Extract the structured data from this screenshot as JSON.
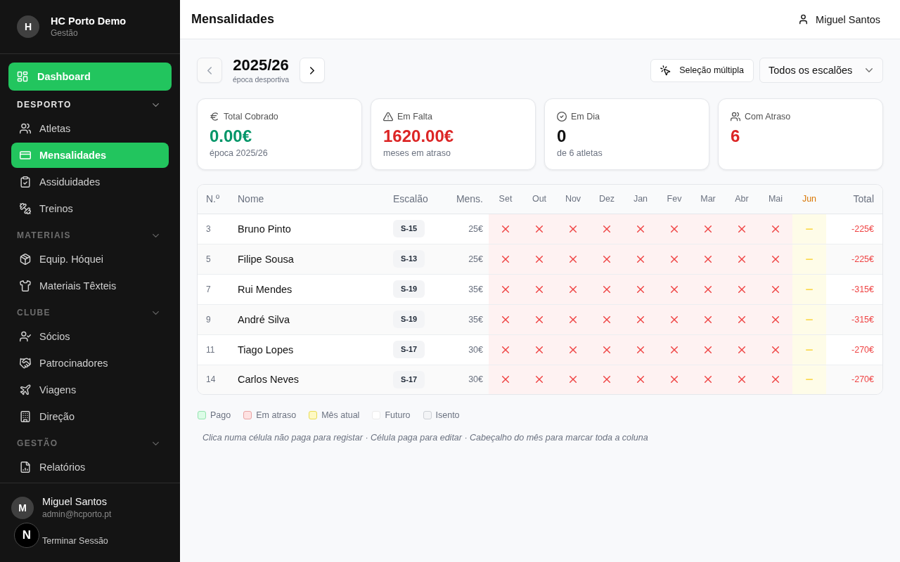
{
  "sidebar": {
    "brand": {
      "avatar": "H",
      "name": "HC Porto Demo",
      "subtitle": "Gestão"
    },
    "dashboard": {
      "label": "Dashboard",
      "selected": true
    },
    "sections": [
      {
        "title": "DESPORTO",
        "active": true,
        "expanded": true,
        "items": [
          {
            "label": "Atletas",
            "selected": false
          },
          {
            "label": "Mensalidades",
            "selected": true
          },
          {
            "label": "Assiduidades",
            "selected": false
          },
          {
            "label": "Treinos",
            "selected": false
          }
        ]
      },
      {
        "title": "MATERIAIS",
        "active": false,
        "expanded": true,
        "items": [
          {
            "label": "Equip. Hóquei",
            "selected": false
          },
          {
            "label": "Materiais Têxteis",
            "selected": false
          }
        ]
      },
      {
        "title": "CLUBE",
        "active": false,
        "expanded": true,
        "items": [
          {
            "label": "Sócios",
            "selected": false
          },
          {
            "label": "Patrocinadores",
            "selected": false
          },
          {
            "label": "Viagens",
            "selected": false
          },
          {
            "label": "Direção",
            "selected": false
          }
        ]
      },
      {
        "title": "GESTÃO",
        "active": false,
        "expanded": true,
        "items": [
          {
            "label": "Relatórios",
            "selected": false
          }
        ]
      }
    ],
    "user": {
      "avatar": "M",
      "name": "Miguel Santos",
      "email": "admin@hcporto.pt"
    },
    "logout": {
      "label": "Terminar Sessão"
    },
    "dev_badge": {
      "label": "N"
    }
  },
  "top_bar": {
    "title": "Mensalidades",
    "user": "Miguel Santos"
  },
  "season": {
    "label": "2025/26",
    "caption": "época desportiva",
    "prev_button": {
      "disabled": true
    },
    "next_button": {
      "disabled": false
    }
  },
  "toolbar": {
    "multi_select_button": "Seleção múltipla",
    "filter": {
      "value": "Todos os escalões"
    }
  },
  "stats": [
    {
      "label": "Total Cobrado",
      "value": "0.00€",
      "note": "época 2025/26",
      "color": "#059669"
    },
    {
      "label": "Em Falta",
      "value": "1620.00€",
      "note": "meses em atraso",
      "color": "#dc2626"
    },
    {
      "label": "Em Dia",
      "value": "0",
      "note": "de 6 atletas",
      "color": "#111111"
    },
    {
      "label": "Com Atraso",
      "value": "6",
      "color": "#dc2626"
    }
  ],
  "table": {
    "columns": {
      "number": "N.º",
      "name": "Nome",
      "team": "Escalão",
      "fee": "Mens.",
      "total": "Total"
    },
    "months": [
      {
        "label": "Set",
        "current": false
      },
      {
        "label": "Out",
        "current": false
      },
      {
        "label": "Nov",
        "current": false
      },
      {
        "label": "Dez",
        "current": false
      },
      {
        "label": "Jan",
        "current": false
      },
      {
        "label": "Fev",
        "current": false
      },
      {
        "label": "Mar",
        "current": false
      },
      {
        "label": "Abr",
        "current": false
      },
      {
        "label": "Mai",
        "current": false
      },
      {
        "label": "Jun",
        "current": true
      }
    ],
    "rows": [
      {
        "number": "3",
        "name": "Bruno Pinto",
        "team": "S-15",
        "fee": "25€",
        "months": [
          {
            "kind": "overdue"
          },
          {
            "kind": "overdue"
          },
          {
            "kind": "overdue"
          },
          {
            "kind": "overdue"
          },
          {
            "kind": "overdue"
          },
          {
            "kind": "overdue"
          },
          {
            "kind": "overdue"
          },
          {
            "kind": "overdue"
          },
          {
            "kind": "overdue"
          },
          {
            "kind": "current"
          }
        ],
        "total": "-225€"
      },
      {
        "number": "5",
        "name": "Filipe Sousa",
        "team": "S-13",
        "fee": "25€",
        "months": [
          {
            "kind": "overdue"
          },
          {
            "kind": "overdue"
          },
          {
            "kind": "overdue"
          },
          {
            "kind": "overdue"
          },
          {
            "kind": "overdue"
          },
          {
            "kind": "overdue"
          },
          {
            "kind": "overdue"
          },
          {
            "kind": "overdue"
          },
          {
            "kind": "overdue"
          },
          {
            "kind": "current"
          }
        ],
        "total": "-225€"
      },
      {
        "number": "7",
        "name": "Rui Mendes",
        "team": "S-19",
        "fee": "35€",
        "months": [
          {
            "kind": "overdue"
          },
          {
            "kind": "overdue"
          },
          {
            "kind": "overdue"
          },
          {
            "kind": "overdue"
          },
          {
            "kind": "overdue"
          },
          {
            "kind": "overdue"
          },
          {
            "kind": "overdue"
          },
          {
            "kind": "overdue"
          },
          {
            "kind": "overdue"
          },
          {
            "kind": "current"
          }
        ],
        "total": "-315€"
      },
      {
        "number": "9",
        "name": "André Silva",
        "team": "S-19",
        "fee": "35€",
        "months": [
          {
            "kind": "overdue"
          },
          {
            "kind": "overdue"
          },
          {
            "kind": "overdue"
          },
          {
            "kind": "overdue"
          },
          {
            "kind": "overdue"
          },
          {
            "kind": "overdue"
          },
          {
            "kind": "overdue"
          },
          {
            "kind": "overdue"
          },
          {
            "kind": "overdue"
          },
          {
            "kind": "current"
          }
        ],
        "total": "-315€"
      },
      {
        "number": "11",
        "name": "Tiago Lopes",
        "team": "S-17",
        "fee": "30€",
        "months": [
          {
            "kind": "overdue"
          },
          {
            "kind": "overdue"
          },
          {
            "kind": "overdue"
          },
          {
            "kind": "overdue"
          },
          {
            "kind": "overdue"
          },
          {
            "kind": "overdue"
          },
          {
            "kind": "overdue"
          },
          {
            "kind": "overdue"
          },
          {
            "kind": "overdue"
          },
          {
            "kind": "current"
          }
        ],
        "total": "-270€"
      },
      {
        "number": "14",
        "name": "Carlos Neves",
        "team": "S-17",
        "fee": "30€",
        "months": [
          {
            "kind": "overdue"
          },
          {
            "kind": "overdue"
          },
          {
            "kind": "overdue"
          },
          {
            "kind": "overdue"
          },
          {
            "kind": "overdue"
          },
          {
            "kind": "overdue"
          },
          {
            "kind": "overdue"
          },
          {
            "kind": "overdue"
          },
          {
            "kind": "overdue"
          },
          {
            "kind": "current"
          }
        ],
        "total": "-270€"
      }
    ]
  },
  "legend": [
    {
      "label": "Pago",
      "color": "#dcfce7"
    },
    {
      "label": "Em atraso",
      "color": "#fee2e2"
    },
    {
      "label": "Mês atual",
      "color": "#fef9c3"
    },
    {
      "label": "Futuro",
      "color": "#ffffff"
    },
    {
      "label": "Isento",
      "color": "#f3f4f6"
    }
  ],
  "hint": "Clica numa célula não paga para registar · Célula paga para editar · Cabeçalho do mês para marcar toda a coluna"
}
